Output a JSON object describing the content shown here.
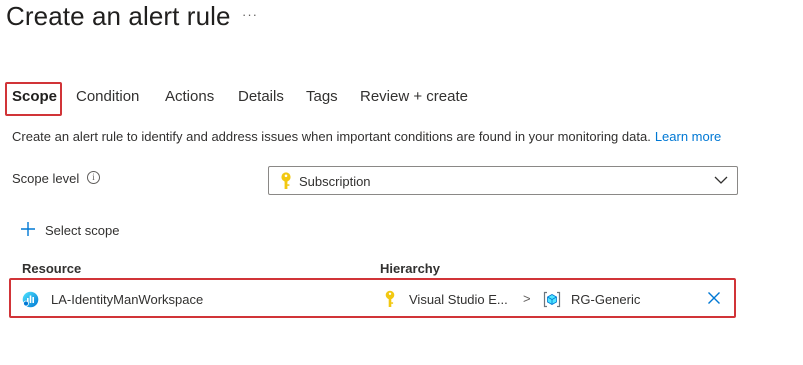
{
  "page": {
    "title": "Create an alert rule",
    "more": "···"
  },
  "tabs": [
    "Scope",
    "Condition",
    "Actions",
    "Details",
    "Tags",
    "Review + create"
  ],
  "description": {
    "text": "Create an alert rule to identify and address issues when important conditions are found in your monitoring data.",
    "link": "Learn more"
  },
  "scope_level": {
    "label": "Scope level",
    "info_symbol": "i",
    "value": "Subscription"
  },
  "select_scope": {
    "label": "Select scope"
  },
  "table": {
    "headers": [
      "Resource",
      "Hierarchy"
    ],
    "rows": [
      {
        "resource": "LA-IdentityManWorkspace",
        "hierarchy_parent": "Visual Studio E...",
        "separator": ">",
        "hierarchy_child": "RG-Generic"
      }
    ]
  },
  "colors": {
    "accent": "#0078d4",
    "highlight": "#d13438",
    "key": "#f2c811"
  }
}
